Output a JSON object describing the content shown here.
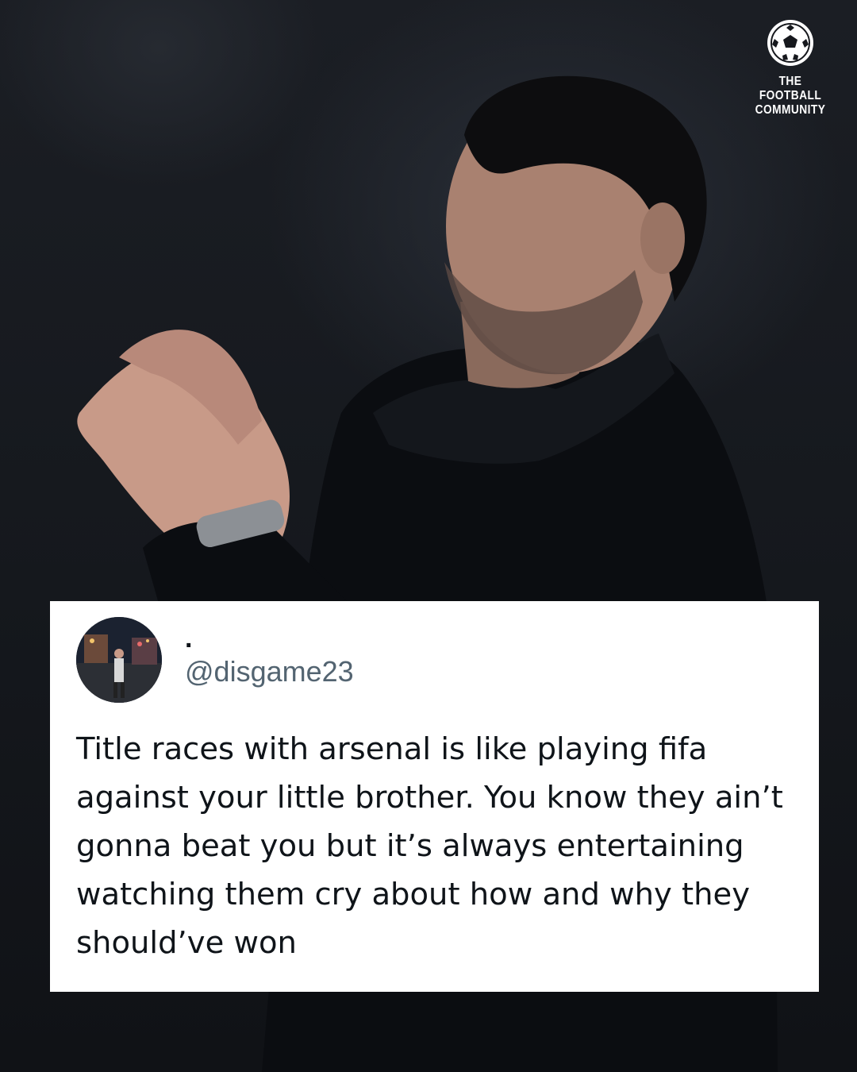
{
  "brand": {
    "line1": "The Football",
    "line2": "Community",
    "icon": "football-icon"
  },
  "tweet": {
    "display_name": ".",
    "handle": "@disgame23",
    "text": "Title races with arsenal is like playing fifa against your little brother. You know they ain’t gonna beat you but it’s always entertaining watching them cry about how and why they should’ve won"
  },
  "colors": {
    "background": "#15181d",
    "card": "#ffffff",
    "text": "#0f1419",
    "handle": "#536471"
  }
}
